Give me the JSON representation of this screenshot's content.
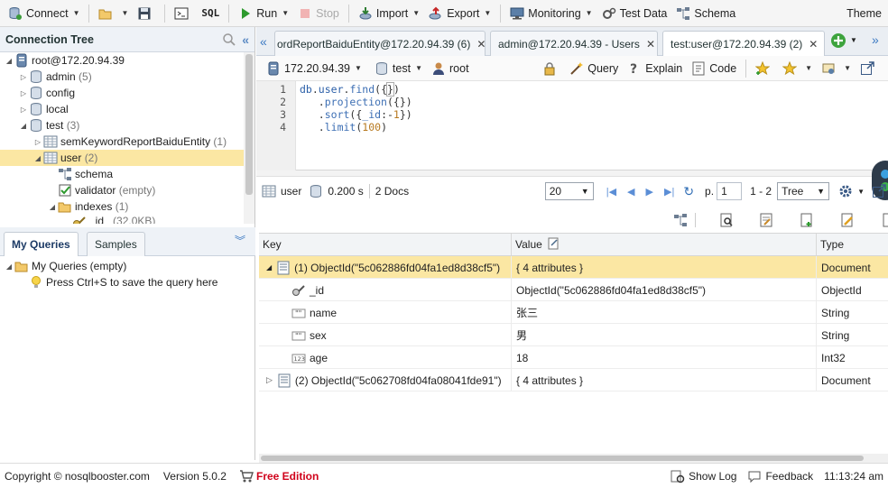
{
  "toolbar": {
    "connect": "Connect",
    "sql": "SQL",
    "run": "Run",
    "stop": "Stop",
    "import": "Import",
    "export": "Export",
    "monitoring": "Monitoring",
    "test_data": "Test Data",
    "schema": "Schema",
    "theme": "Theme"
  },
  "connection_tree": {
    "title": "Connection Tree",
    "root": "root@172.20.94.39",
    "items": [
      {
        "label": "admin",
        "count": "(5)"
      },
      {
        "label": "config",
        "count": ""
      },
      {
        "label": "local",
        "count": ""
      },
      {
        "label": "test",
        "count": "(3)"
      },
      {
        "label": "semKeywordReportBaiduEntity",
        "count": "(1)"
      },
      {
        "label": "user",
        "count": "(2)"
      },
      {
        "label": "schema",
        "count": ""
      },
      {
        "label": "validator",
        "count": "(empty)"
      },
      {
        "label": "indexes",
        "count": "(1)"
      },
      {
        "label": "_id_",
        "count": "(32.0KB)"
      }
    ]
  },
  "queries_panel": {
    "tab_my_queries": "My Queries",
    "tab_samples": "Samples",
    "root": "My Queries (empty)",
    "hint": "Press Ctrl+S to save the query here"
  },
  "tabs": [
    {
      "label": "ordReportBaiduEntity@172.20.94.39 (6)"
    },
    {
      "label": "admin@172.20.94.39 - Users"
    },
    {
      "label": "test:user@172.20.94.39 (2)"
    }
  ],
  "query_bar": {
    "host": "172.20.94.39",
    "db": "test",
    "user": "root",
    "query": "Query",
    "explain": "Explain",
    "code": "Code"
  },
  "editor": {
    "line_numbers": [
      "1",
      "2",
      "3",
      "4"
    ]
  },
  "results": {
    "collection": "user",
    "time": "0.200 s",
    "docs": "2 Docs",
    "page_size": "20",
    "page_label": "p.",
    "page": "1",
    "range": "1 - 2",
    "view": "Tree"
  },
  "grid": {
    "headers": [
      "Key",
      "Value",
      "Type"
    ],
    "rows": [
      {
        "key": "(1) ObjectId(\"5c062886fd04fa1ed8d38cf5\")",
        "value": "{ 4 attributes }",
        "type": "Document"
      },
      {
        "key": "_id",
        "value": "ObjectId(\"5c062886fd04fa1ed8d38cf5\")",
        "type": "ObjectId"
      },
      {
        "key": "name",
        "value": "张三",
        "type": "String"
      },
      {
        "key": "sex",
        "value": "男",
        "type": "String"
      },
      {
        "key": "age",
        "value": "18",
        "type": "Int32"
      },
      {
        "key": "(2) ObjectId(\"5c062708fd04fa08041fde91\")",
        "value": "{ 4 attributes }",
        "type": "Document"
      }
    ]
  },
  "status": {
    "copyright": "Copyright ©  nosqlbooster.com",
    "version": "Version 5.0.2",
    "edition": "Free Edition",
    "show_log": "Show Log",
    "feedback": "Feedback",
    "time": "11:13:24 am"
  },
  "colors": {
    "selection": "#fbe7a3",
    "free_edition": "#d0021b",
    "accent_blue": "#2f6db5"
  }
}
